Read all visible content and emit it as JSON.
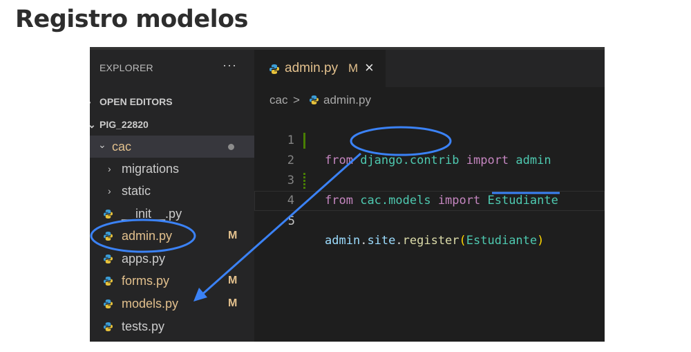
{
  "slide": {
    "title": "Registro modelos"
  },
  "explorer": {
    "header": "EXPLORER",
    "more": "···",
    "open_editors": "OPEN EDITORS",
    "project": "PIG_22820",
    "folder": "cac",
    "folders": [
      {
        "label": "migrations"
      },
      {
        "label": "static"
      }
    ],
    "files": [
      {
        "label": "__init__.py",
        "badge": ""
      },
      {
        "label": "admin.py",
        "badge": "M"
      },
      {
        "label": "apps.py",
        "badge": ""
      },
      {
        "label": "forms.py",
        "badge": "M"
      },
      {
        "label": "models.py",
        "badge": "M"
      },
      {
        "label": "tests.py",
        "badge": ""
      }
    ]
  },
  "editor": {
    "tab": {
      "label": "admin.py",
      "status": "M",
      "close": "×"
    },
    "breadcrumb": {
      "folder": "cac",
      "separator": ">",
      "file": "admin.py"
    },
    "lines": [
      {
        "number": "1",
        "tokens": [
          "from",
          " ",
          "django.contrib",
          " ",
          "import",
          " ",
          "admin"
        ]
      },
      {
        "number": "2",
        "tokens": [
          "from",
          " ",
          "cac.models",
          " ",
          "import",
          " ",
          "Estudiante"
        ]
      },
      {
        "number": "3",
        "tokens": []
      },
      {
        "number": "4",
        "tokens": [
          "admin",
          ".",
          "site",
          ".",
          "register",
          "(",
          "Estudiante",
          ")"
        ]
      },
      {
        "number": "5",
        "tokens": []
      }
    ]
  },
  "colors": {
    "annotation_blue": "#3b82f6",
    "modified": "#e2c08d",
    "keyword": "#c586c0",
    "module": "#4ec9b0"
  },
  "icons": [
    "python-file-icon",
    "chevron-right-icon",
    "chevron-down-icon",
    "close-icon",
    "more-icon",
    "modified-dot-icon"
  ]
}
